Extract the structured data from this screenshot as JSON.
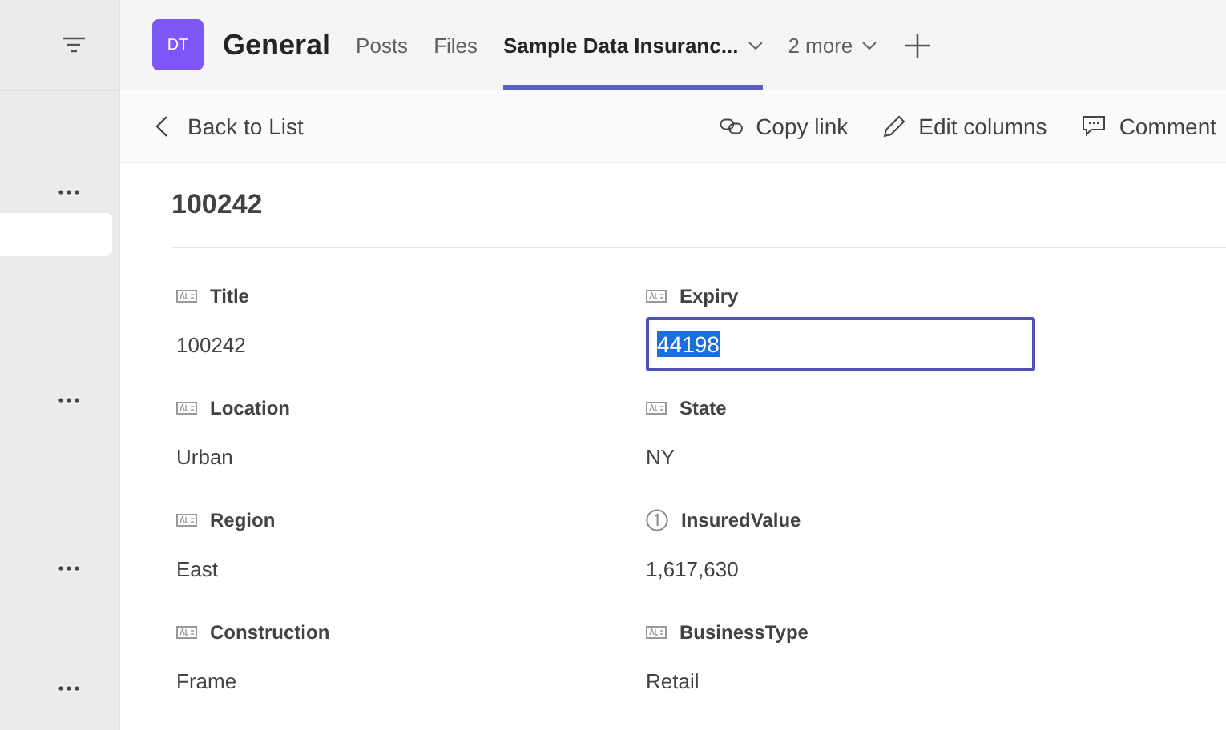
{
  "rail": {
    "items": [
      {
        "selected": false,
        "more": true
      },
      {
        "selected": true,
        "more": false
      },
      {
        "selected": false,
        "more": true
      },
      {
        "selected": false,
        "more": true
      },
      {
        "selected": false,
        "more": true
      }
    ]
  },
  "header": {
    "avatar": "DT",
    "channel": "General",
    "tabs": [
      {
        "label": "Posts",
        "selected": false,
        "dropdown": false
      },
      {
        "label": "Files",
        "selected": false,
        "dropdown": false
      },
      {
        "label": "Sample Data Insuranc...",
        "selected": true,
        "dropdown": true
      },
      {
        "label": "2 more",
        "selected": false,
        "dropdown": true
      }
    ]
  },
  "toolbar": {
    "back": "Back to List",
    "actions": [
      {
        "kind": "link",
        "label": "Copy link"
      },
      {
        "kind": "edit",
        "label": "Edit columns"
      },
      {
        "kind": "comment",
        "label": "Comment"
      }
    ]
  },
  "record": {
    "title": "100242",
    "fields": [
      {
        "label": "Title",
        "kind": "text",
        "value": "100242",
        "editing": false
      },
      {
        "label": "Expiry",
        "kind": "text",
        "value": "44198",
        "editing": true
      },
      {
        "label": "Location",
        "kind": "text",
        "value": "Urban",
        "editing": false
      },
      {
        "label": "State",
        "kind": "text",
        "value": "NY",
        "editing": false
      },
      {
        "label": "Region",
        "kind": "text",
        "value": "East",
        "editing": false
      },
      {
        "label": "InsuredValue",
        "kind": "number",
        "value": "1,617,630",
        "editing": false
      },
      {
        "label": "Construction",
        "kind": "text",
        "value": "Frame",
        "editing": false
      },
      {
        "label": "BusinessType",
        "kind": "text",
        "value": "Retail",
        "editing": false
      }
    ]
  }
}
